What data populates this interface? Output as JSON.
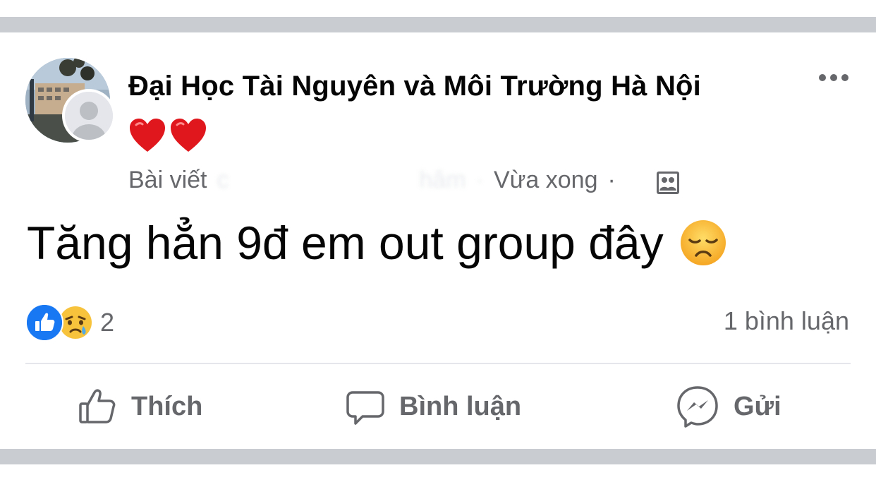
{
  "post": {
    "author": "Đại Học Tài Nguyên và Môi Trường Hà Nội",
    "meta_prefix": "Bài viết",
    "meta_hidden_1": "c",
    "meta_hidden_2": "hâm",
    "meta_separator_1": "·",
    "meta_time": "Vừa xong",
    "meta_separator_2": "·",
    "text": "Tăng hẳn 9đ em out group đây",
    "hearts_icon": "red-heart-icon",
    "emoji_icon": "disappointed-face-icon"
  },
  "reactions": {
    "count": "2",
    "types": [
      "like-icon",
      "crying-face-icon"
    ]
  },
  "comments_count": "1 bình luận",
  "actions": {
    "like_label": "Thích",
    "comment_label": "Bình luận",
    "send_label": "Gửi"
  },
  "colors": {
    "separator": "#c9ccd1",
    "secondary_text": "#65676b",
    "like_blue": "#1877f2",
    "heart_red": "#e0181e"
  }
}
